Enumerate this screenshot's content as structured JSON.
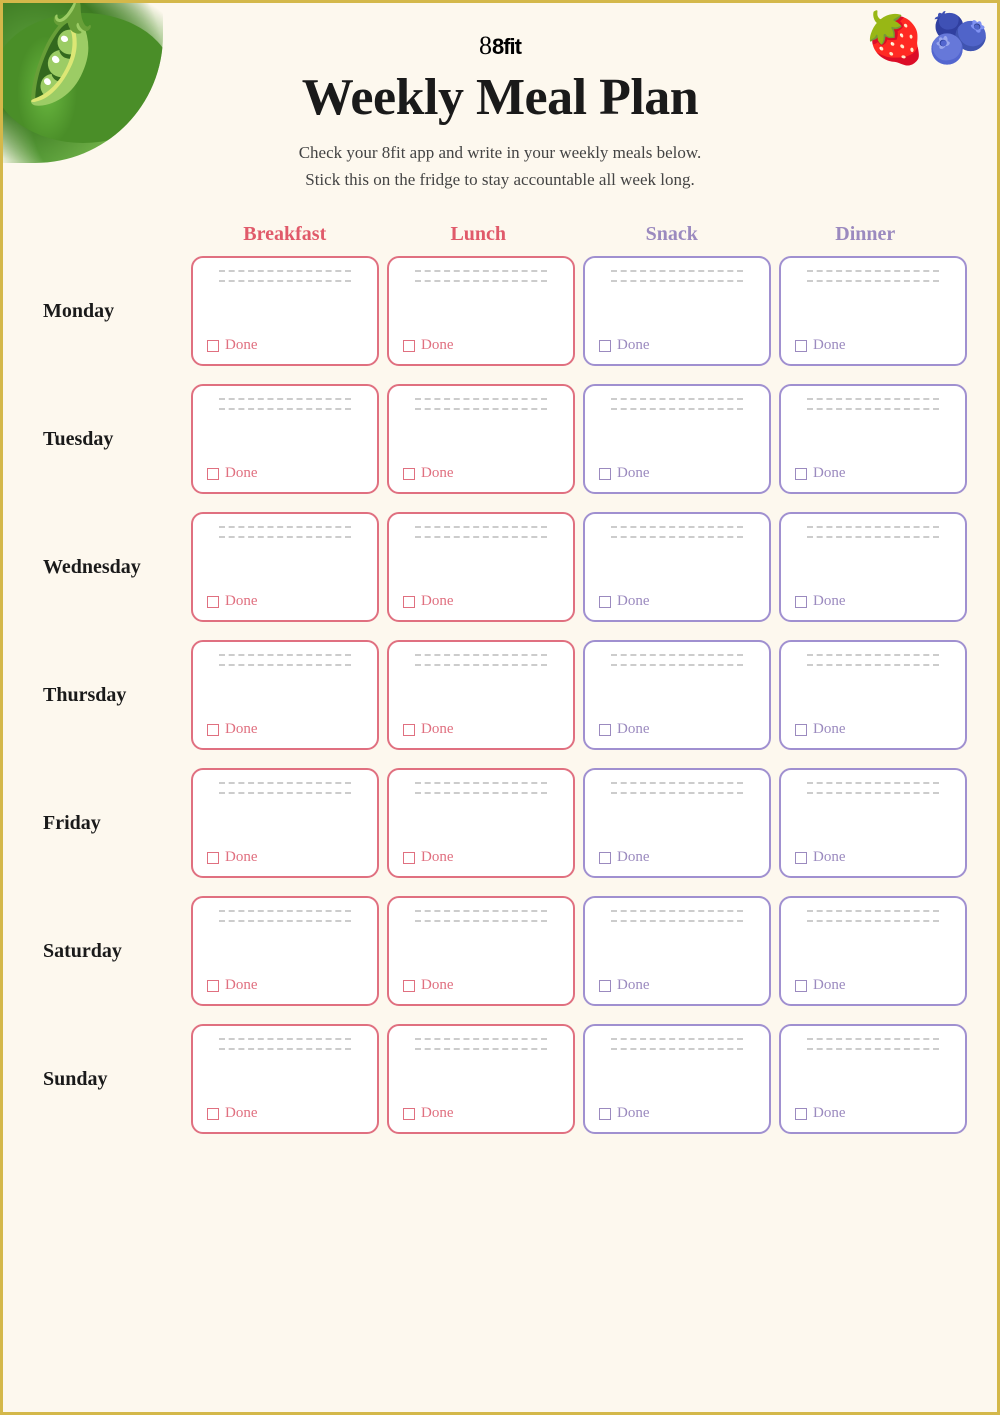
{
  "logo": "8fit",
  "title": "Weekly Meal Plan",
  "subtitle_line1": "Check your 8fit app and write in your weekly meals below.",
  "subtitle_line2": "Stick this on the fridge to stay accountable all week long.",
  "columns": {
    "empty": "",
    "breakfast": "Breakfast",
    "lunch": "Lunch",
    "snack": "Snack",
    "dinner": "Dinner"
  },
  "done_label": "Done",
  "days": [
    {
      "name": "Monday"
    },
    {
      "name": "Tuesday"
    },
    {
      "name": "Wednesday"
    },
    {
      "name": "Thursday"
    },
    {
      "name": "Friday"
    },
    {
      "name": "Saturday"
    },
    {
      "name": "Sunday"
    }
  ],
  "colors": {
    "breakfast_border": "#e07080",
    "lunch_border": "#e07080",
    "snack_border": "#a090d0",
    "dinner_border": "#a090d0",
    "breakfast_text": "#e05a6a",
    "lunch_text": "#e05a6a",
    "snack_text": "#9b8abf",
    "dinner_text": "#9b8abf"
  }
}
